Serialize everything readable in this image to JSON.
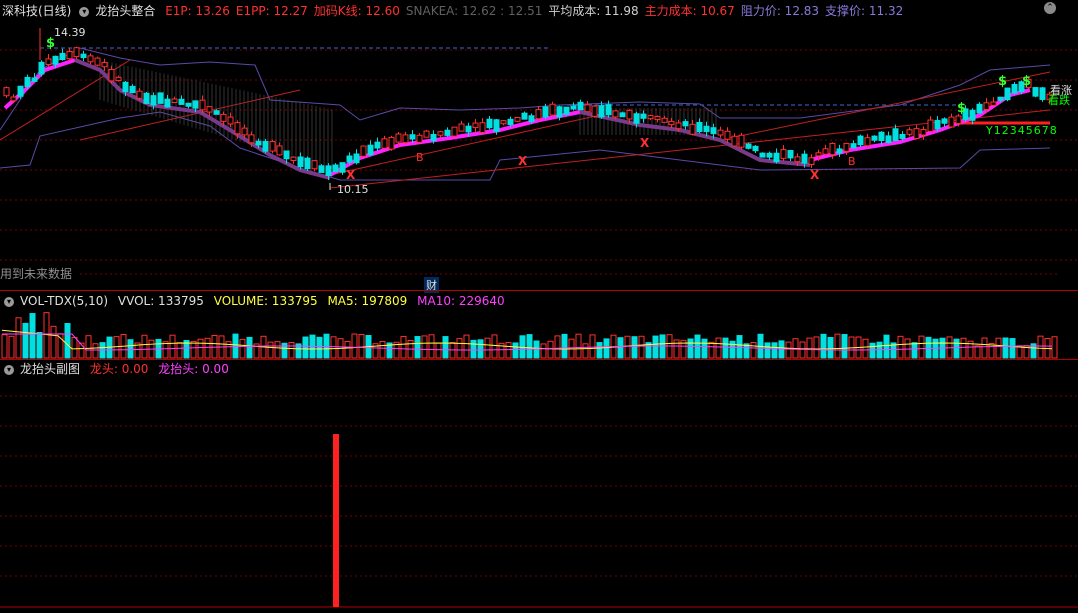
{
  "header": {
    "stock": "深科技(日线)",
    "indicator": "龙抬头整合",
    "items": [
      {
        "label": "E1P: 13.26",
        "color": "#ff3030"
      },
      {
        "label": "E1PP: 12.27",
        "color": "#ff3030"
      },
      {
        "label": "加码K线: 12.60",
        "color": "#ff3030"
      },
      {
        "label": "SNAKEA: 12.62 : 12.51",
        "color": "#606060"
      },
      {
        "label": "平均成本: 11.98",
        "color": "#d0d0d0"
      },
      {
        "label": "主力成本: 10.67",
        "color": "#ff3030"
      },
      {
        "label": "阻力价: 12.83",
        "color": "#8a7ad8"
      },
      {
        "label": "支撑价: 11.32",
        "color": "#8a7ad8"
      }
    ],
    "collapse_icon": "chevron-up-icon"
  },
  "main_chart": {
    "high_label": "14.39",
    "low_label": "10.15",
    "future_data_note": "用到未来数据",
    "finance_marker": "财",
    "signal_buy": "B",
    "signal_sell": "X",
    "signal_dollar": "$",
    "right_label_1": "看涨",
    "right_label_2": "看跌",
    "wave_count": "Y12345678"
  },
  "volume_panel": {
    "name": "VOL-TDX(5,10)",
    "vvol": "VVOL: 133795",
    "volume": "VOLUME: 133795",
    "ma5": "MA5: 197809",
    "ma10": "MA10: 229640"
  },
  "sub_panel": {
    "name": "龙抬头副图",
    "longtou": "龙头: 0.00",
    "longtaitou": "龙抬头: 0.00"
  },
  "colors": {
    "up": "#ff3030",
    "down": "#00e0e0",
    "magenta": "#ff20ff",
    "purple": "#8a7ad8",
    "grid": "#7a0000"
  }
}
